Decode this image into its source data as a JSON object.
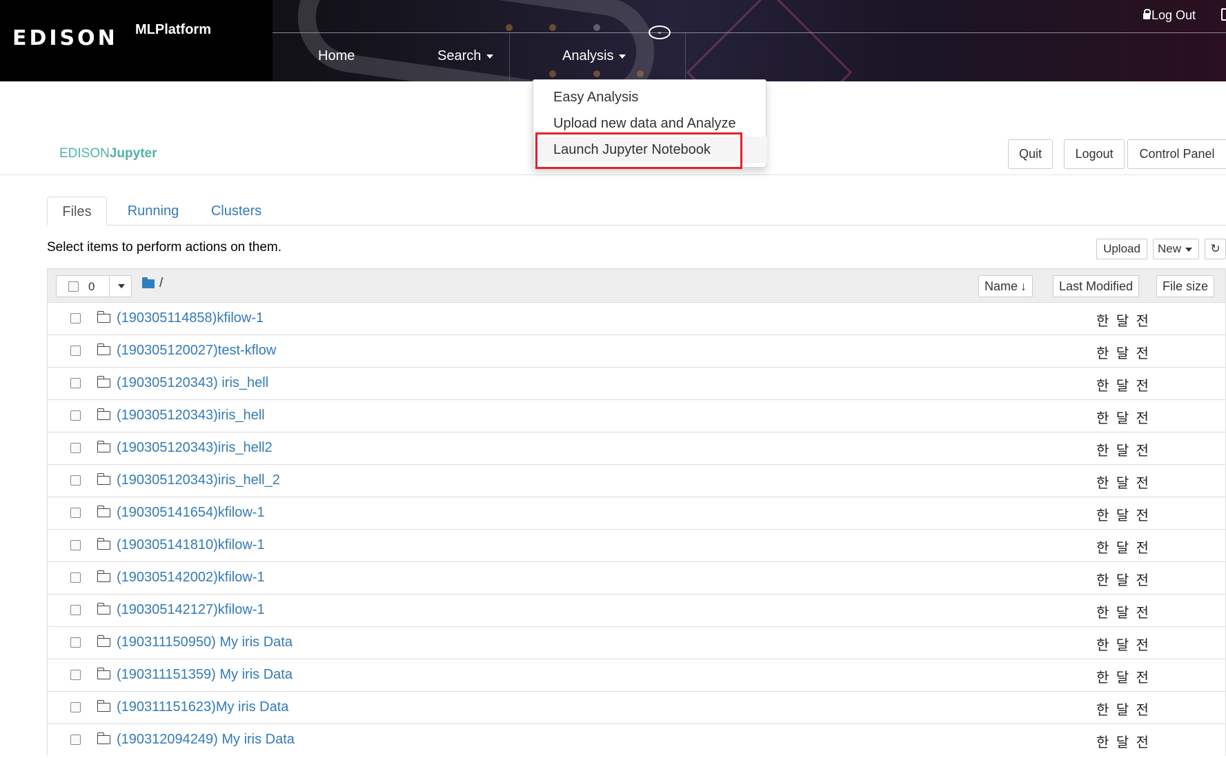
{
  "banner": {
    "logo": "EDISON",
    "app_title": "MLPlatform",
    "logout": "Log Out",
    "nav": [
      {
        "label": "Home"
      },
      {
        "label": "Search"
      },
      {
        "label": "Analysis"
      }
    ]
  },
  "analysis_menu": {
    "items": [
      {
        "label": "Easy Analysis"
      },
      {
        "label": "Upload new data and Analyze"
      },
      {
        "label": "Launch Jupyter Notebook"
      }
    ],
    "highlight_color": "#e5202a"
  },
  "jupyter_header": {
    "logo_prefix": "EDISON",
    "logo_suffix": "Jupyter",
    "buttons": {
      "quit": "Quit",
      "logout": "Logout",
      "control_panel": "Control Panel"
    }
  },
  "tabs": [
    {
      "label": "Files",
      "active": true
    },
    {
      "label": "Running",
      "active": false
    },
    {
      "label": "Clusters",
      "active": false
    }
  ],
  "toolbar": {
    "hint": "Select items to perform actions on them.",
    "upload": "Upload",
    "new": "New"
  },
  "list_header": {
    "selected_count": "0",
    "path": "/",
    "columns": {
      "name": "Name",
      "last_modified": "Last Modified",
      "file_size": "File size"
    }
  },
  "files": [
    {
      "name": "(190305114858)kfilow-1",
      "modified": "한 달 전"
    },
    {
      "name": "(190305120027)test-kflow",
      "modified": "한 달 전"
    },
    {
      "name": "(190305120343) iris_hell",
      "modified": "한 달 전"
    },
    {
      "name": "(190305120343)iris_hell",
      "modified": "한 달 전"
    },
    {
      "name": "(190305120343)iris_hell2",
      "modified": "한 달 전"
    },
    {
      "name": "(190305120343)iris_hell_2",
      "modified": "한 달 전"
    },
    {
      "name": "(190305141654)kfilow-1",
      "modified": "한 달 전"
    },
    {
      "name": "(190305141810)kfilow-1",
      "modified": "한 달 전"
    },
    {
      "name": "(190305142002)kfilow-1",
      "modified": "한 달 전"
    },
    {
      "name": "(190305142127)kfilow-1",
      "modified": "한 달 전"
    },
    {
      "name": "(190311150950) My iris Data",
      "modified": "한 달 전"
    },
    {
      "name": "(190311151359) My iris Data",
      "modified": "한 달 전"
    },
    {
      "name": "(190311151623)My iris Data",
      "modified": "한 달 전"
    },
    {
      "name": "(190312094249) My iris Data",
      "modified": "한 달 전"
    }
  ]
}
